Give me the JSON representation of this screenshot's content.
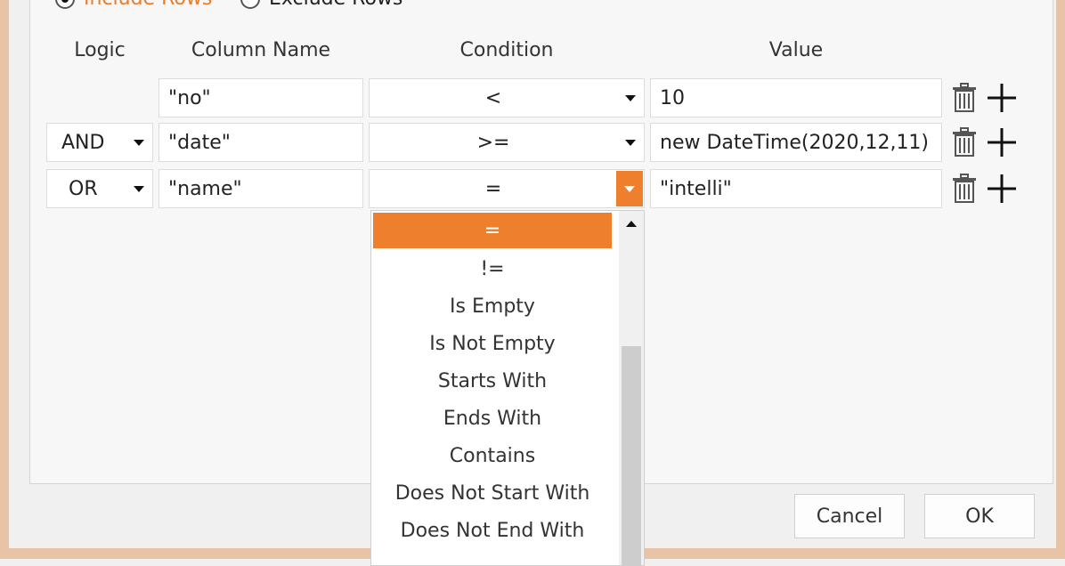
{
  "filter_mode": {
    "include_label": "Include Rows",
    "exclude_label": "Exclude Rows",
    "selected": "include"
  },
  "headers": {
    "logic": "Logic",
    "column_name": "Column Name",
    "condition": "Condition",
    "value": "Value"
  },
  "rows": [
    {
      "logic": "",
      "column": "\"no\"",
      "condition": "<",
      "value": "10"
    },
    {
      "logic": "AND",
      "column": "\"date\"",
      "condition": ">=",
      "value": "new DateTime(2020,12,11)"
    },
    {
      "logic": "OR",
      "column": "\"name\"",
      "condition": "=",
      "value": "\"intelli\""
    }
  ],
  "condition_dropdown": {
    "options": [
      "=",
      "!=",
      "Is Empty",
      "Is Not Empty",
      "Starts With",
      "Ends With",
      "Contains",
      "Does Not Start With",
      "Does Not End With"
    ],
    "selected": "="
  },
  "footer": {
    "cancel_label": "Cancel",
    "ok_label": "OK"
  },
  "colors": {
    "accent": "#ee7f2d",
    "window_border": "#e8c3a6"
  },
  "icons": [
    "trash-icon",
    "plus-icon",
    "dropdown-arrow-icon",
    "scroll-up-icon"
  ]
}
